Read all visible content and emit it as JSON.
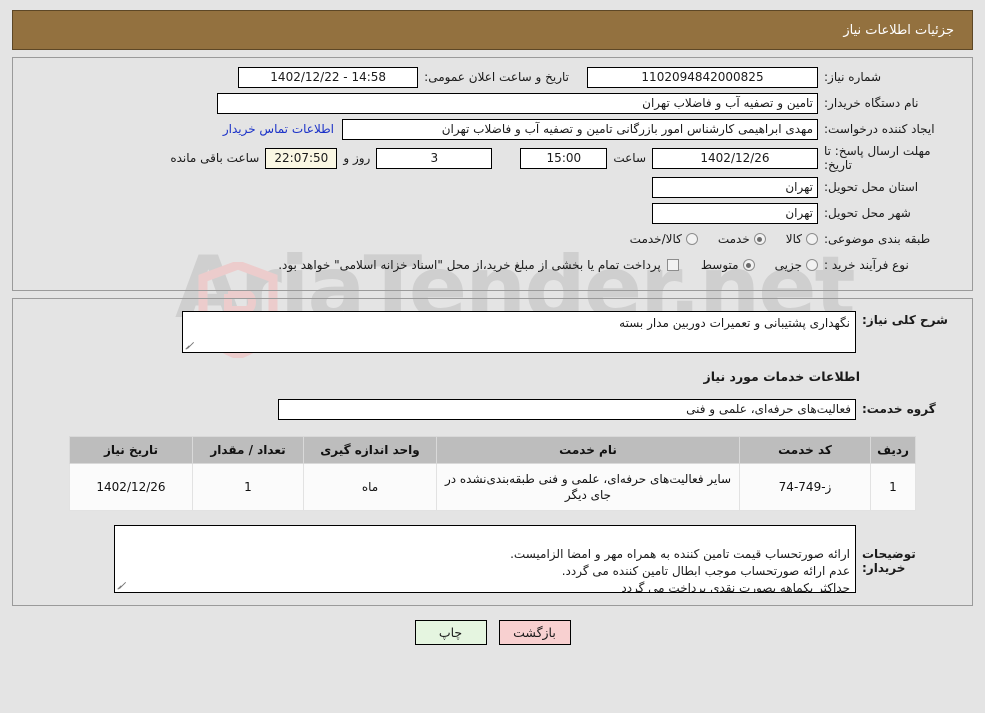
{
  "header": {
    "title": "جزئیات اطلاعات نیاز"
  },
  "form": {
    "labels": {
      "need_number": "شماره نیاز:",
      "buyer_org": "نام دستگاه خریدار:",
      "creator": "ایجاد کننده درخواست:",
      "deadline": "مهلت ارسال پاسخ: تا تاریخ:",
      "province": "استان محل تحویل:",
      "city": "شهر محل تحویل:",
      "category": "طبقه بندی موضوعی:",
      "process_type": "نوع فرآیند خرید :",
      "public_announce": "تاریخ و ساعت اعلان عمومی:",
      "hour": "ساعت",
      "day_and": "روز و",
      "hours_remaining": "ساعت باقی مانده",
      "contact_link": "اطلاعات تماس خریدار"
    },
    "values": {
      "need_number": "1102094842000825",
      "buyer_org": "تامین و تصفیه آب و فاضلاب تهران",
      "creator": "مهدی ابراهیمی کارشناس امور بازرگانی تامین و تصفیه آب و فاضلاب تهران",
      "deadline_date": "1402/12/26",
      "deadline_time": "15:00",
      "days_remaining": "3",
      "timer": "22:07:50",
      "province": "تهران",
      "city": "تهران",
      "public_announce": "14:58 - 1402/12/22"
    },
    "category_options": [
      {
        "label": "کالا",
        "selected": false
      },
      {
        "label": "خدمت",
        "selected": true
      },
      {
        "label": "کالا/خدمت",
        "selected": false
      }
    ],
    "process_options": [
      {
        "label": "جزیی",
        "selected": false
      },
      {
        "label": "متوسط",
        "selected": true
      }
    ],
    "treasury_checkbox": {
      "label": "پرداخت تمام یا بخشی از مبلغ خرید،از محل \"اسناد خزانه اسلامی\" خواهد بود.",
      "checked": false
    }
  },
  "detail": {
    "need_desc_label": "شرح کلی نیاز:",
    "need_desc_value": "نگهداری پشتیبانی و تعمیرات دوربین مدار بسته",
    "services_section_title": "اطلاعات خدمات مورد نیاز",
    "service_group_label": "گروه خدمت:",
    "service_group_value": "فعالیت‌های حرفه‌ای، علمی و فنی",
    "buyer_notes_label": "توضیحات خریدار:",
    "buyer_notes_value": "ارائه صورتحساب قیمت تامین کننده به همراه مهر و امضا الزامیست.\nعدم ارائه صورتحساب موجب ابطال تامین کننده می گردد.\nحداکثر یکماهه بصورت نقدی پرداخت می گردد"
  },
  "table": {
    "headers": [
      "ردیف",
      "کد خدمت",
      "نام خدمت",
      "واحد اندازه گیری",
      "تعداد / مقدار",
      "تاریخ نیاز"
    ],
    "rows": [
      {
        "row": "1",
        "code": "ز-749-74",
        "name": "سایر فعالیت‌های حرفه‌ای، علمی و فنی طبقه‌بندی‌نشده در جای دیگر",
        "unit": "ماه",
        "qty": "1",
        "date": "1402/12/26"
      }
    ]
  },
  "footer": {
    "back_label": "بازگشت",
    "print_label": "چاپ"
  },
  "watermark": {
    "text": "AriaTender.net"
  },
  "colors": {
    "header_bg": "#93713f",
    "link": "#1a31c8",
    "btn_back": "#f8d0d0",
    "btn_print": "#e5f5e0",
    "timer_bg": "#faf7e3",
    "table_head": "#bdbdbd"
  }
}
